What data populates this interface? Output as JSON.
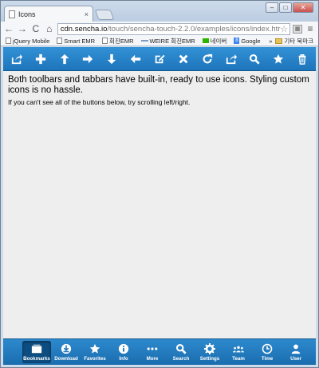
{
  "browser": {
    "tab_title": "Icons",
    "tab_close": "×",
    "window_buttons": [
      "–",
      "□",
      "✕"
    ],
    "nav": {
      "back": "←",
      "forward": "→",
      "reload": "C",
      "home": "⌂"
    },
    "url_host": "cdn.sencha.io",
    "url_path": "/touch/sencha-touch-2.2.0/examples/icons/index.htr",
    "star": "☆",
    "extension_label": "▦",
    "menu": "≡",
    "bookmarks": [
      {
        "label": "jQuery Mobile",
        "icon": "bookmark-page-icon",
        "kind": "page"
      },
      {
        "label": "Smart EMR",
        "icon": "bookmark-page-icon",
        "kind": "page"
      },
      {
        "label": "회진EMR",
        "icon": "bookmark-page-icon",
        "kind": "page"
      },
      {
        "label": "WEIRE 회진EMR",
        "icon": "bookmark-line-icon",
        "kind": "line"
      },
      {
        "label": "네이버",
        "icon": "naver-icon",
        "kind": "green"
      },
      {
        "label": "Google",
        "icon": "google-icon",
        "kind": "gg"
      }
    ],
    "bookmarks_overflow": "»",
    "other_bookmarks": "기타 북마크"
  },
  "app": {
    "toolbar_icons": [
      "action-icon",
      "add-icon",
      "arrow-up-icon",
      "arrow-right-icon",
      "arrow-down-icon",
      "arrow-left-icon",
      "compose-icon",
      "delete-icon",
      "refresh-icon",
      "reply-icon",
      "search-icon",
      "star-icon",
      "trash-icon"
    ],
    "lead_text": "Both toolbars and tabbars have built-in, ready to use icons. Styling custom icons is no hassle.",
    "note_text": "If you can't see all of the buttons below, try scrolling left/right.",
    "tabs": [
      {
        "label": "Bookmarks",
        "icon": "bookmarks-icon",
        "active": true
      },
      {
        "label": "Download",
        "icon": "download-icon",
        "active": false
      },
      {
        "label": "Favorites",
        "icon": "favorites-icon",
        "active": false
      },
      {
        "label": "Info",
        "icon": "info-icon",
        "active": false
      },
      {
        "label": "More",
        "icon": "more-icon",
        "active": false
      },
      {
        "label": "Search",
        "icon": "search-icon",
        "active": false
      },
      {
        "label": "Settings",
        "icon": "settings-icon",
        "active": false
      },
      {
        "label": "Team",
        "icon": "team-icon",
        "active": false
      },
      {
        "label": "Time",
        "icon": "time-icon",
        "active": false
      },
      {
        "label": "User",
        "icon": "user-icon",
        "active": false
      }
    ],
    "colors": {
      "toolbar": "#1e75bb",
      "background": "#eeeeee",
      "active_tab": "#0e4d80"
    }
  }
}
